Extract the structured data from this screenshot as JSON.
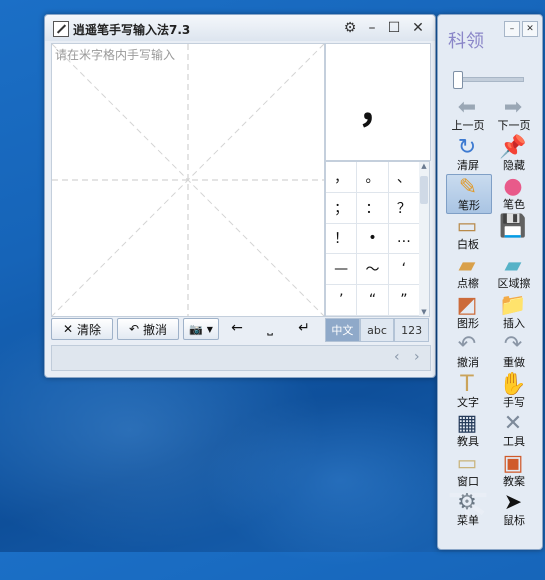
{
  "handwriting_window": {
    "title": "逍遥笔手写输入法7.3",
    "placeholder": "请在米字格内手写输入",
    "candidate": "，",
    "symbols": [
      "，",
      "。",
      "、",
      "；",
      "：",
      "？",
      "！",
      "•",
      "…",
      "—",
      "～",
      "‘",
      "’",
      "“",
      "”"
    ],
    "buttons": {
      "clear": "清除",
      "undo": "撤消"
    },
    "modes": [
      {
        "label": "中文",
        "active": true
      },
      {
        "label": "abc",
        "active": false
      },
      {
        "label": "123",
        "active": false
      }
    ],
    "icons": [
      "gear-icon",
      "minimize-icon",
      "maximize-icon",
      "close-icon",
      "camera-icon",
      "backspace-icon",
      "space-icon",
      "enter-icon"
    ]
  },
  "toolbar": {
    "brand": "科领",
    "tools": [
      {
        "label": "上一页",
        "icon": "left-arrow-icon",
        "color": "#9aa7b5"
      },
      {
        "label": "下一页",
        "icon": "right-arrow-icon",
        "color": "#9aa7b5"
      },
      {
        "label": "清屏",
        "icon": "refresh-icon",
        "color": "#3d7ad1"
      },
      {
        "label": "隐藏",
        "icon": "pin-icon",
        "color": "#2a61b7"
      },
      {
        "label": "笔形",
        "icon": "pencil-icon",
        "color": "#e09a2b",
        "selected": true
      },
      {
        "label": "笔色",
        "icon": "color-wheel-icon",
        "color": "#e85a8a"
      },
      {
        "label": "白板",
        "icon": "whiteboard-icon",
        "color": "#b88a4a"
      },
      {
        "label": "",
        "icon": "save-icon",
        "color": "#2b5ea8"
      },
      {
        "label": "点檫",
        "icon": "eraser-icon",
        "color": "#d9a04a"
      },
      {
        "label": "区域擦",
        "icon": "area-eraser-icon",
        "color": "#56b2c7"
      },
      {
        "label": "图形",
        "icon": "shapes-icon",
        "color": "#cc6b3a"
      },
      {
        "label": "插入",
        "icon": "insert-folder-icon",
        "color": "#3f93c9"
      },
      {
        "label": "撤消",
        "icon": "undo-icon",
        "color": "#8a96a6"
      },
      {
        "label": "重做",
        "icon": "redo-icon",
        "color": "#8a96a6"
      },
      {
        "label": "文字",
        "icon": "text-icon",
        "color": "#caa35a"
      },
      {
        "label": "手写",
        "icon": "hand-icon",
        "color": "#e4b26a"
      },
      {
        "label": "教具",
        "icon": "teaching-tools-icon",
        "color": "#253b5a"
      },
      {
        "label": "工具",
        "icon": "tools-icon",
        "color": "#7d8a9a"
      },
      {
        "label": "窗口",
        "icon": "window-icon",
        "color": "#c9b37a"
      },
      {
        "label": "教案",
        "icon": "lesson-plan-icon",
        "color": "#d05a2a"
      },
      {
        "label": "菜单",
        "icon": "menu-gear-icon",
        "color": "#6a7784"
      },
      {
        "label": "鼠标",
        "icon": "mouse-cursor-icon",
        "color": "#111111"
      }
    ]
  }
}
